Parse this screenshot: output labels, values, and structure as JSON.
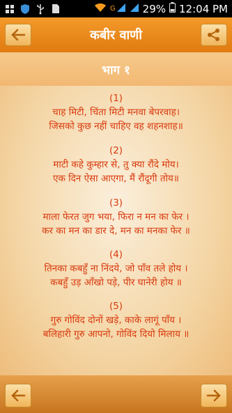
{
  "status_bar": {
    "network_label": "G",
    "battery_percent": "29%",
    "time": "12:04 PM"
  },
  "app_bar": {
    "title": "कबीर वाणी"
  },
  "section": {
    "title": "भाग १"
  },
  "verses": [
    {
      "number": "(1)",
      "line1": "चाह मिटी, चिंता मिटी मनवा बेपरवाह।",
      "line2": "जिसको कुछ नहीं चाहिए वह शहनशाह॥"
    },
    {
      "number": "(2)",
      "line1": "माटी कहे कुम्हार से, तु क्या रौंदे मोय।",
      "line2": "एक दिन ऐसा आएगा, मैं रौंदूगी तोय॥"
    },
    {
      "number": "(3)",
      "line1": "माला फेरत जुग भया, फिरा न मन का फेर ।",
      "line2": "कर का मन का डार दे, मन का मनका फेर ॥"
    },
    {
      "number": "(4)",
      "line1": "तिनका कबहुँ ना निंदये, जो पाँव तले होय ।",
      "line2": "कबहुँ उड़ आँखो पड़े, पीर घानेरी होय ॥"
    },
    {
      "number": "(5)",
      "line1": "गुरु गोविंद दोनों खड़े, काके लागूं पाँय ।",
      "line2": "बलिहारी गुरु आपनो, गोविंद दियो मिलाय ॥"
    }
  ],
  "colors": {
    "app_bar": "#e88a1c",
    "verse_text": "#d93a0e"
  }
}
